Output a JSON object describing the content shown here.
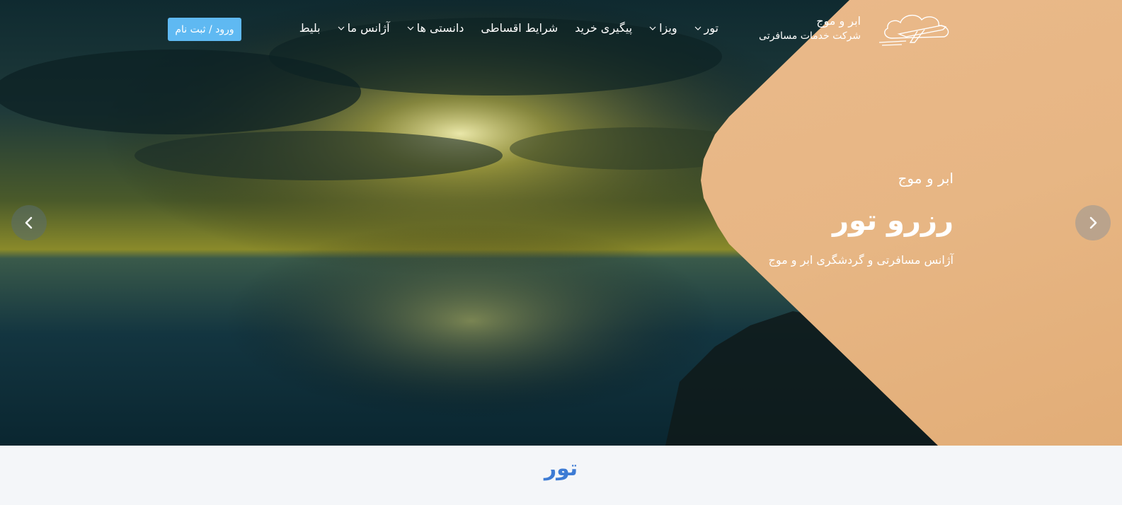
{
  "brand": {
    "name": "ابر و موج",
    "subtitle": "شرکت خدمات مسافرتی",
    "logo_icon": "plane-cloud-logo"
  },
  "nav": {
    "items": [
      {
        "label": "تور",
        "has_dropdown": true
      },
      {
        "label": "ویزا",
        "has_dropdown": true
      },
      {
        "label": "پیگیری خرید",
        "has_dropdown": false
      },
      {
        "label": "شرایط اقساطی",
        "has_dropdown": false
      },
      {
        "label": "دانستی ها",
        "has_dropdown": true
      },
      {
        "label": "آژانس ما",
        "has_dropdown": true
      },
      {
        "label": "بلیط",
        "has_dropdown": false
      }
    ]
  },
  "login_button": {
    "label": "ورود / ثبت نام",
    "color": "#5fb9f2"
  },
  "hero": {
    "eyebrow": "ابر و موج",
    "title": "رزرو تور",
    "description": "آژانس مسافرتی و گردشگری ابر و موج",
    "accent_color": "#e7b684",
    "prev_icon": "chevron-left-icon",
    "next_icon": "chevron-right-icon"
  },
  "section": {
    "title": "تور",
    "color": "#3d7bd4"
  }
}
